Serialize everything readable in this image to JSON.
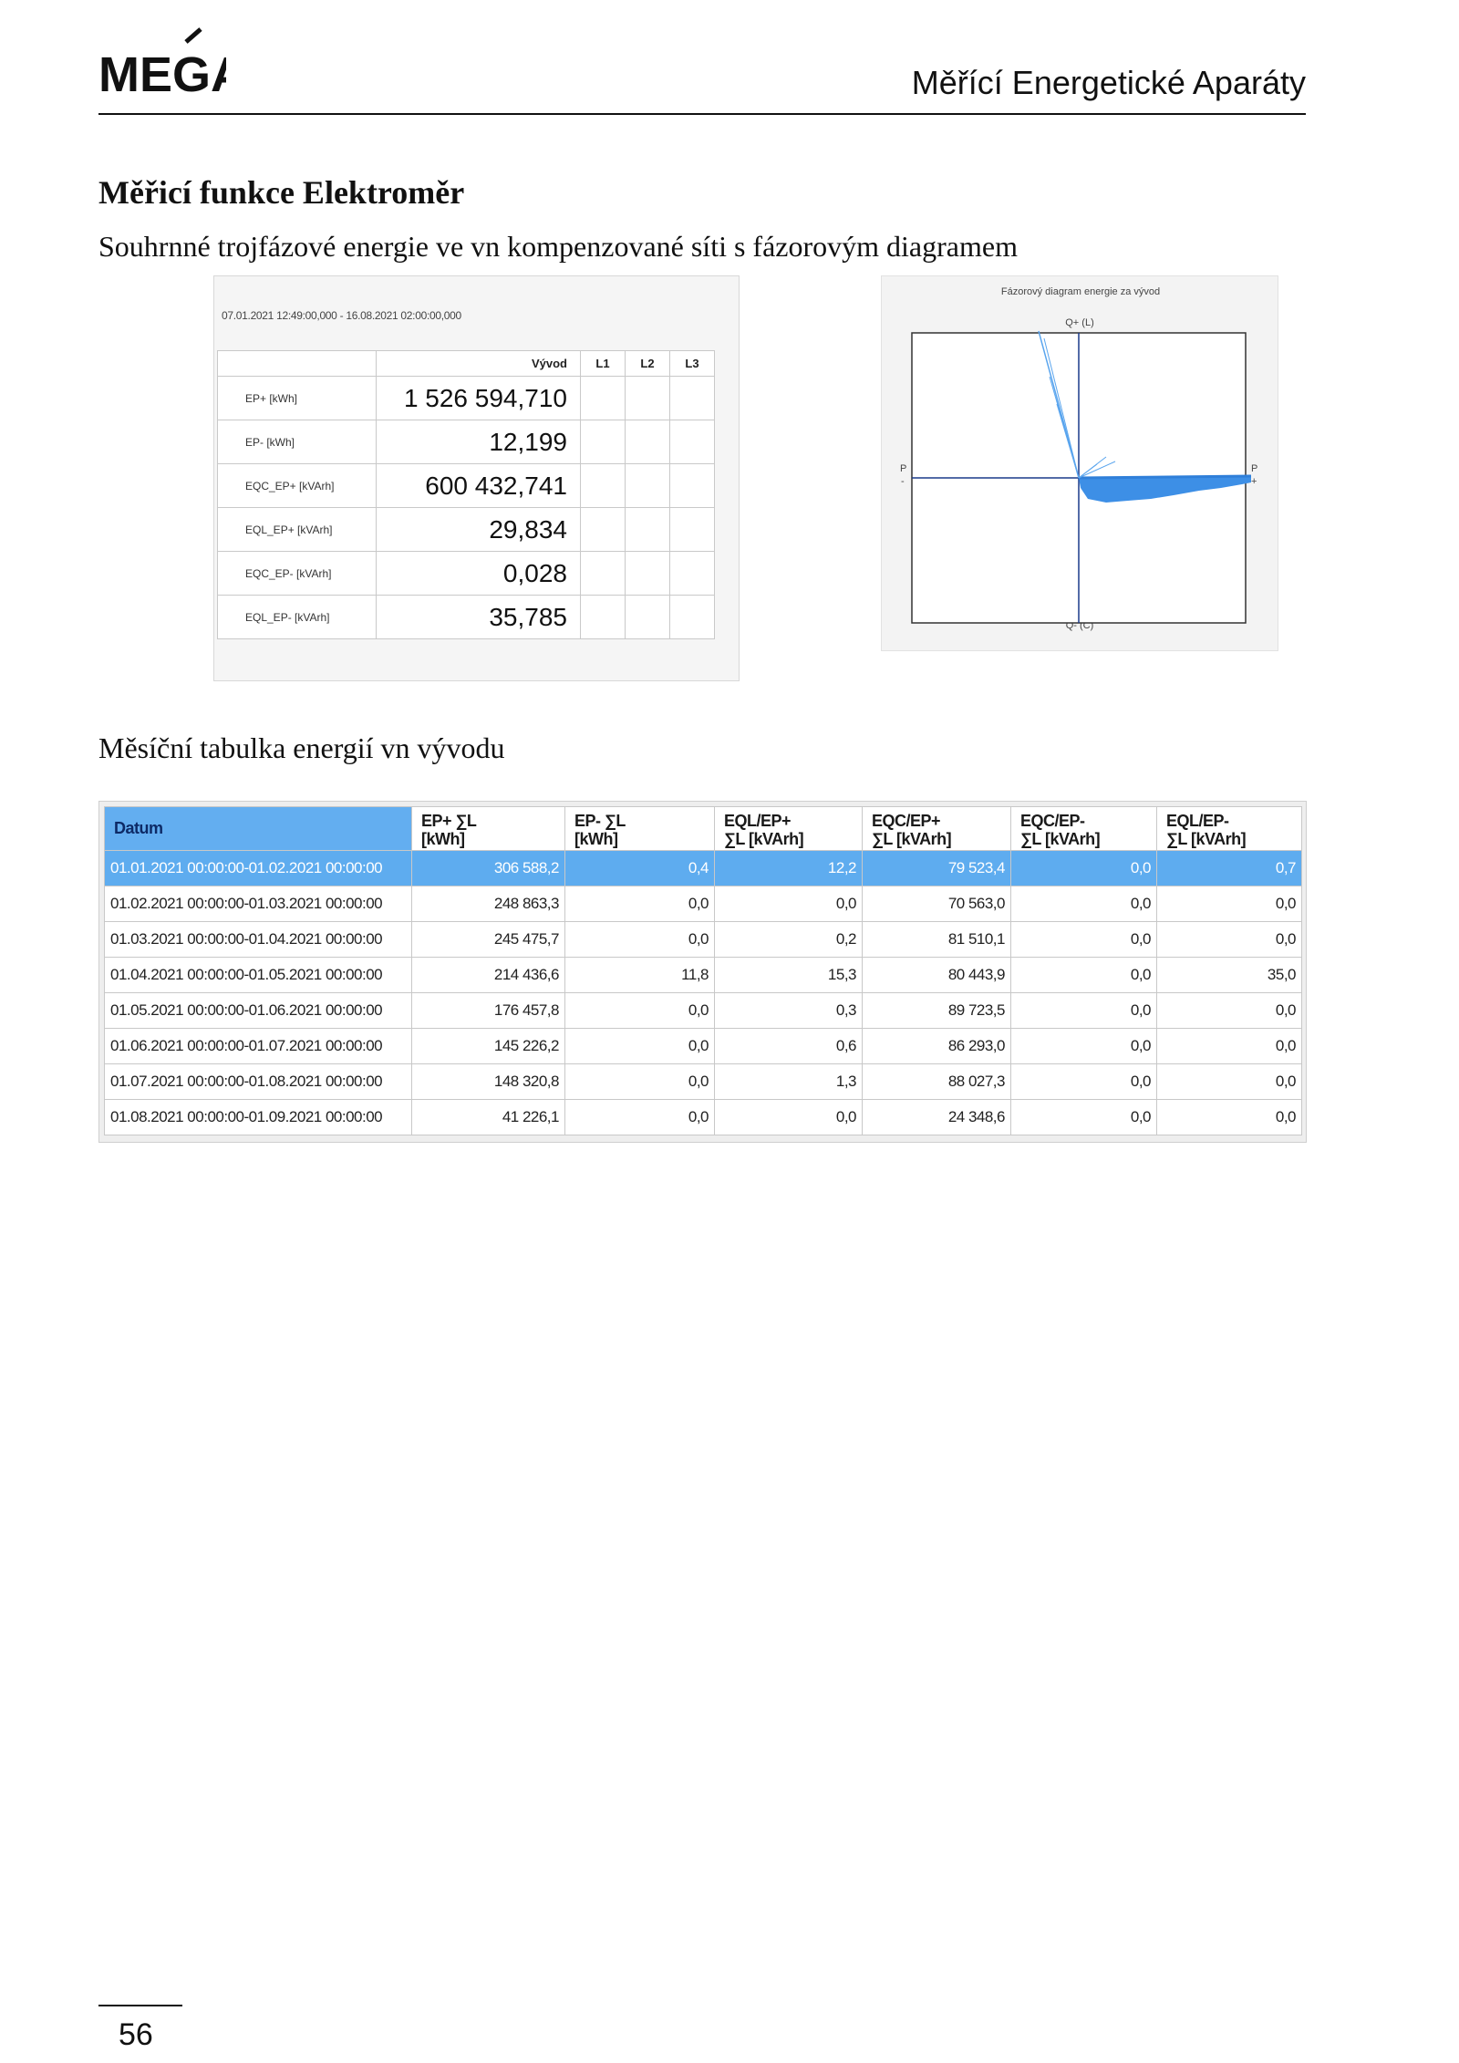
{
  "header": {
    "logo_text": "MEGA",
    "title": "Měřící Energetické Aparáty"
  },
  "section": {
    "heading": "Měřicí funkce Elektroměr",
    "subtitle": "Souhrnné trojfázové energie ve vn kompenzované síti s fázorovým diagramem"
  },
  "summary": {
    "date_range": "07.01.2021 12:49:00,000 - 16.08.2021 02:00:00,000",
    "columns": [
      "",
      "Vývod",
      "L1",
      "L2",
      "L3"
    ],
    "rows": [
      {
        "label": "EP+ [kWh]",
        "value": "1 526 594,710"
      },
      {
        "label": "EP- [kWh]",
        "value": "12,199"
      },
      {
        "label": "EQC_EP+ [kVArh]",
        "value": "600 432,741"
      },
      {
        "label": "EQL_EP+ [kVArh]",
        "value": "29,834"
      },
      {
        "label": "EQC_EP- [kVArh]",
        "value": "0,028"
      },
      {
        "label": "EQL_EP- [kVArh]",
        "value": "35,785"
      }
    ]
  },
  "phasor": {
    "title": "Fázorový diagram energie za vývod",
    "top_label": "Q+ (L)",
    "bottom_label": "Q- (C)",
    "left_label": "P\n-",
    "right_label": "P\n+",
    "left_p": "P",
    "left_sign": "-",
    "right_p": "P",
    "right_sign": "+",
    "colors": {
      "vector": "#5aa5ee",
      "fill": "#3d8fe6",
      "axis": "#1a3a8a",
      "frame": "#333333"
    }
  },
  "monthly": {
    "heading": "Měsíční tabulka energií vn vývodu",
    "columns": [
      {
        "line1": "Datum",
        "line2": ""
      },
      {
        "line1": "EP+ ∑L",
        "line2": "[kWh]"
      },
      {
        "line1": "EP- ∑L",
        "line2": "[kWh]"
      },
      {
        "line1": "EQL/EP+",
        "line2": "∑L [kVArh]"
      },
      {
        "line1": "EQC/EP+",
        "line2": "∑L [kVArh]"
      },
      {
        "line1": "EQC/EP-",
        "line2": "∑L [kVArh]"
      },
      {
        "line1": "EQL/EP-",
        "line2": "∑L [kVArh]"
      }
    ],
    "rows": [
      [
        "01.01.2021 00:00:00-01.02.2021 00:00:00",
        "306 588,2",
        "0,4",
        "12,2",
        "79 523,4",
        "0,0",
        "0,7"
      ],
      [
        "01.02.2021 00:00:00-01.03.2021 00:00:00",
        "248 863,3",
        "0,0",
        "0,0",
        "70 563,0",
        "0,0",
        "0,0"
      ],
      [
        "01.03.2021 00:00:00-01.04.2021 00:00:00",
        "245 475,7",
        "0,0",
        "0,2",
        "81 510,1",
        "0,0",
        "0,0"
      ],
      [
        "01.04.2021 00:00:00-01.05.2021 00:00:00",
        "214 436,6",
        "11,8",
        "15,3",
        "80 443,9",
        "0,0",
        "35,0"
      ],
      [
        "01.05.2021 00:00:00-01.06.2021 00:00:00",
        "176 457,8",
        "0,0",
        "0,3",
        "89 723,5",
        "0,0",
        "0,0"
      ],
      [
        "01.06.2021 00:00:00-01.07.2021 00:00:00",
        "145 226,2",
        "0,0",
        "0,6",
        "86 293,0",
        "0,0",
        "0,0"
      ],
      [
        "01.07.2021 00:00:00-01.08.2021 00:00:00",
        "148 320,8",
        "0,0",
        "1,3",
        "88 027,3",
        "0,0",
        "0,0"
      ],
      [
        "01.08.2021 00:00:00-01.09.2021 00:00:00",
        "41 226,1",
        "0,0",
        "0,0",
        "24 348,6",
        "0,0",
        "0,0"
      ]
    ]
  },
  "footer": {
    "page_number": "56"
  }
}
